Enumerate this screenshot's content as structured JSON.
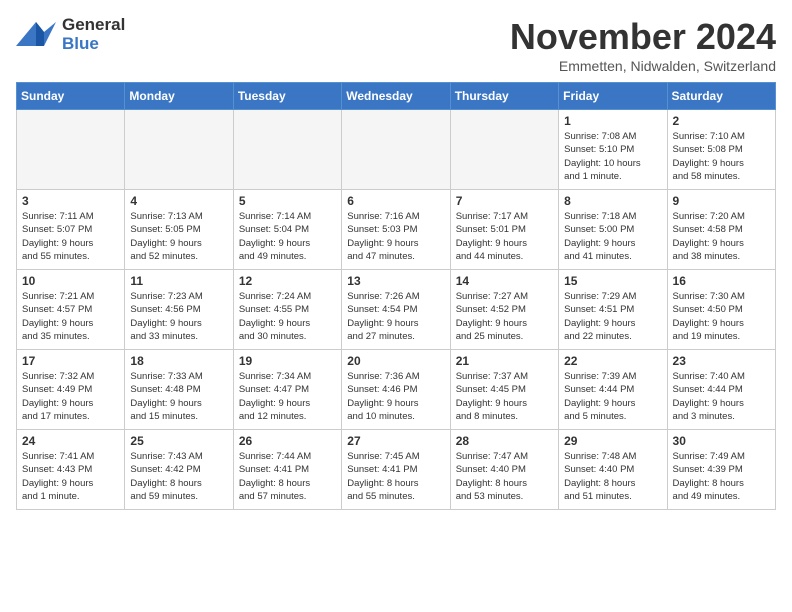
{
  "header": {
    "logo_general": "General",
    "logo_blue": "Blue",
    "month_title": "November 2024",
    "location": "Emmetten, Nidwalden, Switzerland"
  },
  "weekdays": [
    "Sunday",
    "Monday",
    "Tuesday",
    "Wednesday",
    "Thursday",
    "Friday",
    "Saturday"
  ],
  "weeks": [
    [
      {
        "day": "",
        "info": ""
      },
      {
        "day": "",
        "info": ""
      },
      {
        "day": "",
        "info": ""
      },
      {
        "day": "",
        "info": ""
      },
      {
        "day": "",
        "info": ""
      },
      {
        "day": "1",
        "info": "Sunrise: 7:08 AM\nSunset: 5:10 PM\nDaylight: 10 hours\nand 1 minute."
      },
      {
        "day": "2",
        "info": "Sunrise: 7:10 AM\nSunset: 5:08 PM\nDaylight: 9 hours\nand 58 minutes."
      }
    ],
    [
      {
        "day": "3",
        "info": "Sunrise: 7:11 AM\nSunset: 5:07 PM\nDaylight: 9 hours\nand 55 minutes."
      },
      {
        "day": "4",
        "info": "Sunrise: 7:13 AM\nSunset: 5:05 PM\nDaylight: 9 hours\nand 52 minutes."
      },
      {
        "day": "5",
        "info": "Sunrise: 7:14 AM\nSunset: 5:04 PM\nDaylight: 9 hours\nand 49 minutes."
      },
      {
        "day": "6",
        "info": "Sunrise: 7:16 AM\nSunset: 5:03 PM\nDaylight: 9 hours\nand 47 minutes."
      },
      {
        "day": "7",
        "info": "Sunrise: 7:17 AM\nSunset: 5:01 PM\nDaylight: 9 hours\nand 44 minutes."
      },
      {
        "day": "8",
        "info": "Sunrise: 7:18 AM\nSunset: 5:00 PM\nDaylight: 9 hours\nand 41 minutes."
      },
      {
        "day": "9",
        "info": "Sunrise: 7:20 AM\nSunset: 4:58 PM\nDaylight: 9 hours\nand 38 minutes."
      }
    ],
    [
      {
        "day": "10",
        "info": "Sunrise: 7:21 AM\nSunset: 4:57 PM\nDaylight: 9 hours\nand 35 minutes."
      },
      {
        "day": "11",
        "info": "Sunrise: 7:23 AM\nSunset: 4:56 PM\nDaylight: 9 hours\nand 33 minutes."
      },
      {
        "day": "12",
        "info": "Sunrise: 7:24 AM\nSunset: 4:55 PM\nDaylight: 9 hours\nand 30 minutes."
      },
      {
        "day": "13",
        "info": "Sunrise: 7:26 AM\nSunset: 4:54 PM\nDaylight: 9 hours\nand 27 minutes."
      },
      {
        "day": "14",
        "info": "Sunrise: 7:27 AM\nSunset: 4:52 PM\nDaylight: 9 hours\nand 25 minutes."
      },
      {
        "day": "15",
        "info": "Sunrise: 7:29 AM\nSunset: 4:51 PM\nDaylight: 9 hours\nand 22 minutes."
      },
      {
        "day": "16",
        "info": "Sunrise: 7:30 AM\nSunset: 4:50 PM\nDaylight: 9 hours\nand 19 minutes."
      }
    ],
    [
      {
        "day": "17",
        "info": "Sunrise: 7:32 AM\nSunset: 4:49 PM\nDaylight: 9 hours\nand 17 minutes."
      },
      {
        "day": "18",
        "info": "Sunrise: 7:33 AM\nSunset: 4:48 PM\nDaylight: 9 hours\nand 15 minutes."
      },
      {
        "day": "19",
        "info": "Sunrise: 7:34 AM\nSunset: 4:47 PM\nDaylight: 9 hours\nand 12 minutes."
      },
      {
        "day": "20",
        "info": "Sunrise: 7:36 AM\nSunset: 4:46 PM\nDaylight: 9 hours\nand 10 minutes."
      },
      {
        "day": "21",
        "info": "Sunrise: 7:37 AM\nSunset: 4:45 PM\nDaylight: 9 hours\nand 8 minutes."
      },
      {
        "day": "22",
        "info": "Sunrise: 7:39 AM\nSunset: 4:44 PM\nDaylight: 9 hours\nand 5 minutes."
      },
      {
        "day": "23",
        "info": "Sunrise: 7:40 AM\nSunset: 4:44 PM\nDaylight: 9 hours\nand 3 minutes."
      }
    ],
    [
      {
        "day": "24",
        "info": "Sunrise: 7:41 AM\nSunset: 4:43 PM\nDaylight: 9 hours\nand 1 minute."
      },
      {
        "day": "25",
        "info": "Sunrise: 7:43 AM\nSunset: 4:42 PM\nDaylight: 8 hours\nand 59 minutes."
      },
      {
        "day": "26",
        "info": "Sunrise: 7:44 AM\nSunset: 4:41 PM\nDaylight: 8 hours\nand 57 minutes."
      },
      {
        "day": "27",
        "info": "Sunrise: 7:45 AM\nSunset: 4:41 PM\nDaylight: 8 hours\nand 55 minutes."
      },
      {
        "day": "28",
        "info": "Sunrise: 7:47 AM\nSunset: 4:40 PM\nDaylight: 8 hours\nand 53 minutes."
      },
      {
        "day": "29",
        "info": "Sunrise: 7:48 AM\nSunset: 4:40 PM\nDaylight: 8 hours\nand 51 minutes."
      },
      {
        "day": "30",
        "info": "Sunrise: 7:49 AM\nSunset: 4:39 PM\nDaylight: 8 hours\nand 49 minutes."
      }
    ]
  ]
}
